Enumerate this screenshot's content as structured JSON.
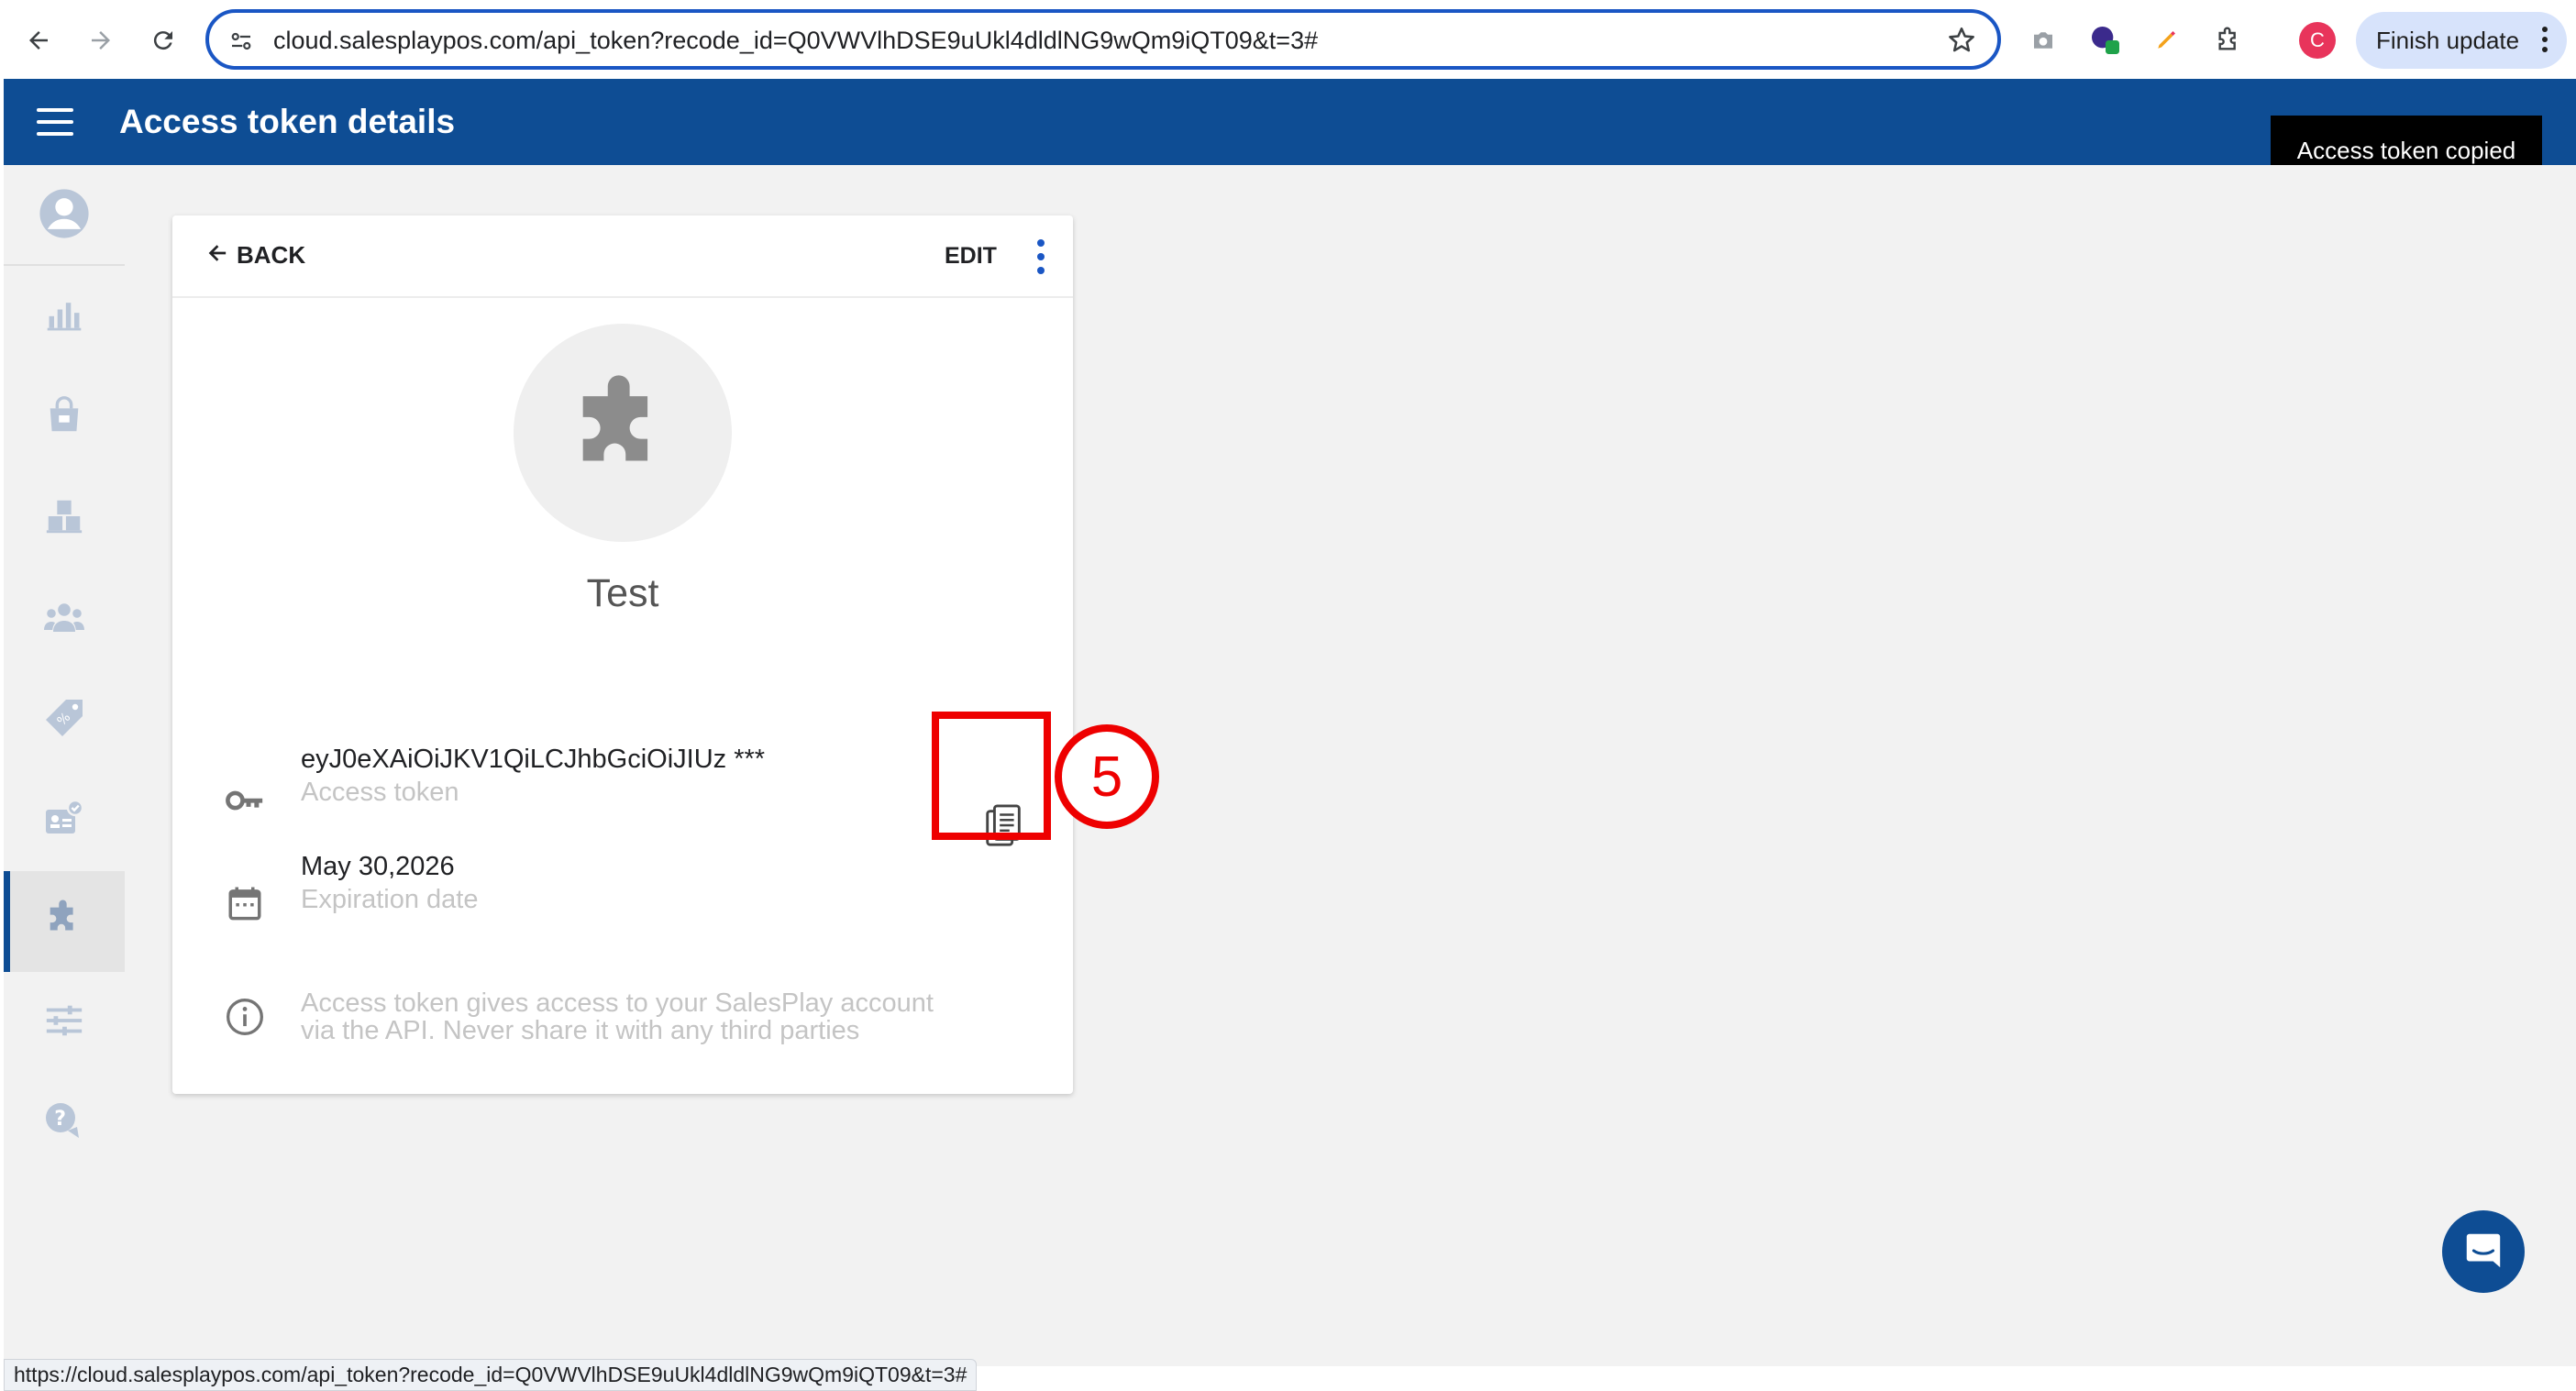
{
  "browser": {
    "url": "cloud.salesplaypos.com/api_token?recode_id=Q0VWVlhDSE9uUkl4dldlNG9wQm9iQT09&t=3#",
    "profile_initial": "C",
    "finish_update_label": "Finish update",
    "status_url": "https://cloud.salesplaypos.com/api_token?recode_id=Q0VWVlhDSE9uUkl4dldlNG9wQm9iQT09&t=3#"
  },
  "header": {
    "title": "Access token details"
  },
  "toast": {
    "message": "Access token copied"
  },
  "sidebar": {
    "items": [
      {
        "icon": "account-icon"
      },
      {
        "icon": "reports-icon"
      },
      {
        "icon": "items-icon"
      },
      {
        "icon": "inventory-icon"
      },
      {
        "icon": "customers-icon"
      },
      {
        "icon": "discounts-icon"
      },
      {
        "icon": "employees-icon"
      },
      {
        "icon": "integrations-icon",
        "active": true
      },
      {
        "icon": "settings-icon"
      },
      {
        "icon": "help-icon"
      }
    ]
  },
  "card": {
    "back_label": "BACK",
    "edit_label": "EDIT",
    "name": "Test",
    "token_value": "eyJ0eXAiOiJKV1QiLCJhbGciOiJIUz ***",
    "token_caption": "Access token",
    "expiration_value": "May 30,2026",
    "expiration_caption": "Expiration date",
    "info_line1": "Access token gives access to your SalesPlay account",
    "info_line2": "via the API. Never share it with any third parties"
  },
  "annotation": {
    "step_number": "5",
    "color": "#ee0000"
  },
  "colors": {
    "brand_blue": "#0e4d94",
    "accent_blue": "#1a56c4"
  }
}
